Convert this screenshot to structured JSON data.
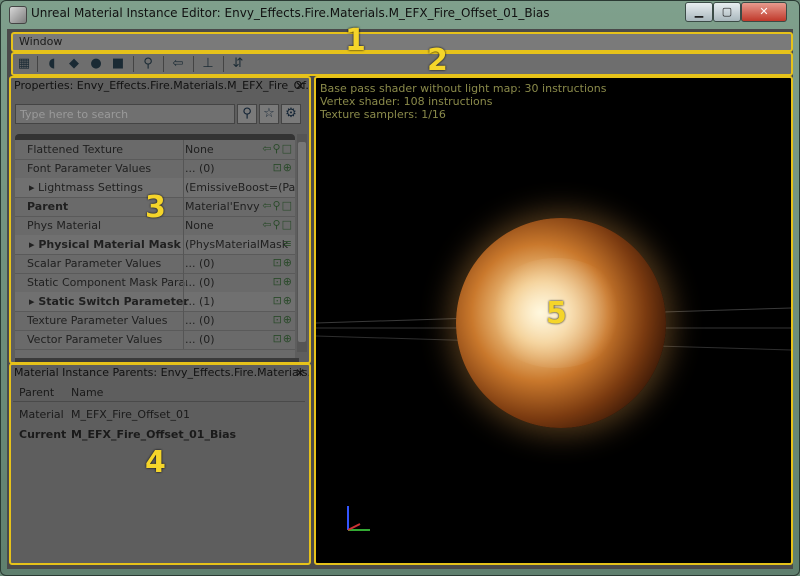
{
  "window": {
    "title": "Unreal Material Instance Editor: Envy_Effects.Fire.Materials.M_EFX_Fire_Offset_01_Bias",
    "minimize": "▁",
    "maximize": "▢",
    "close": "✕"
  },
  "menu": {
    "items": [
      "Window"
    ]
  },
  "toolbar": {
    "icons": [
      "grid-icon",
      "cylinder-icon",
      "cube-icon",
      "sphere-icon",
      "plane-icon",
      "magnifier-icon",
      "back-arrow-icon",
      "tripod-icon",
      "apply-icon"
    ],
    "glyphs": [
      "▦",
      "◖",
      "◆",
      "●",
      "■",
      "⚲",
      "⇦",
      "⊥",
      "⇵"
    ]
  },
  "properties": {
    "title": "Properties: Envy_Effects.Fire.Materials.M_EFX_Fire_Of...",
    "close": "✕",
    "search_placeholder": "Type here to search",
    "rows": [
      {
        "name": "Flattened Texture",
        "value": "None",
        "icons": "⇦⚲□",
        "group": false,
        "bold": false
      },
      {
        "name": "Font Parameter Values",
        "value": "... (0)",
        "icons": "⊡⊕",
        "group": false,
        "bold": false
      },
      {
        "name": "▸ Lightmass Settings",
        "value": "(EmissiveBoost=(Parar",
        "icons": "",
        "group": true,
        "bold": false
      },
      {
        "name": "Parent",
        "value": "Material'Envy",
        "icons": "⇦⚲□",
        "group": false,
        "bold": true
      },
      {
        "name": "Phys Material",
        "value": "None",
        "icons": "⇦⚲□",
        "group": false,
        "bold": false
      },
      {
        "name": "▸ Physical Material Mask",
        "value": "(PhysMaterialMask",
        "icons": "≡",
        "group": true,
        "bold": true
      },
      {
        "name": "Scalar Parameter Values",
        "value": "... (0)",
        "icons": "⊡⊕",
        "group": false,
        "bold": false
      },
      {
        "name": "Static Component Mask Parame",
        "value": "... (0)",
        "icons": "⊡⊕",
        "group": false,
        "bold": false
      },
      {
        "name": "▸ Static Switch Parameter",
        "value": "... (1)",
        "icons": "⊡⊕",
        "group": true,
        "bold": true
      },
      {
        "name": "Texture Parameter Values",
        "value": "... (0)",
        "icons": "⊡⊕",
        "group": false,
        "bold": false
      },
      {
        "name": "Vector Parameter Values",
        "value": "... (0)",
        "icons": "⊡⊕",
        "group": false,
        "bold": false
      }
    ]
  },
  "parents": {
    "title": "Material Instance Parents: Envy_Effects.Fire.Materials...",
    "close": "✕",
    "col_parent": "Parent",
    "col_name": "Name",
    "rows": [
      {
        "parent": "Material",
        "name": "M_EFX_Fire_Offset_01",
        "current": false
      },
      {
        "parent": "Current",
        "name": "M_EFX_Fire_Offset_01_Bias",
        "current": true
      }
    ]
  },
  "viewport": {
    "stats": [
      "Base pass shader without light map: 30 instructions",
      "Vertex shader: 108 instructions",
      "Texture samplers: 1/16"
    ]
  },
  "annotations": {
    "n1": "1",
    "n2": "2",
    "n3": "3",
    "n4": "4",
    "n5": "5"
  }
}
